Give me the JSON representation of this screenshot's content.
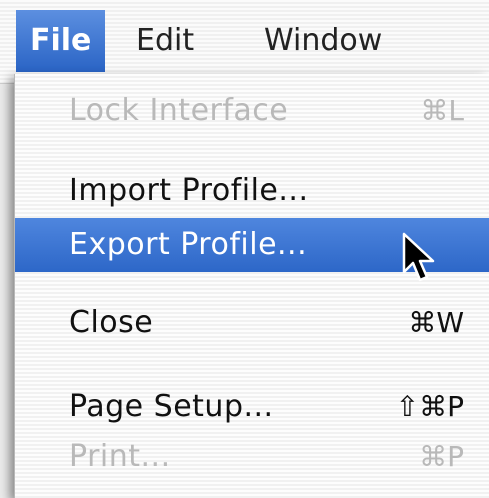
{
  "menubar": {
    "titles": [
      {
        "label": "File",
        "active": true
      },
      {
        "label": "Edit",
        "active": false
      },
      {
        "label": "Window",
        "active": false
      }
    ]
  },
  "file_menu": {
    "items": [
      {
        "label": "Lock Interface",
        "shortcut": "⌘L",
        "enabled": false
      },
      {
        "label": "Import Profile...",
        "shortcut": "",
        "enabled": true
      },
      {
        "label": "Export Profile...",
        "shortcut": "",
        "enabled": true,
        "highlighted": true
      },
      {
        "label": "Close",
        "shortcut": "⌘W",
        "enabled": true
      },
      {
        "label": "Page Setup...",
        "shortcut": "⇧⌘P",
        "enabled": true
      },
      {
        "label": "Print...",
        "shortcut": "⌘P",
        "enabled": false
      }
    ]
  },
  "cursor_icon": "arrow-pointer-icon"
}
